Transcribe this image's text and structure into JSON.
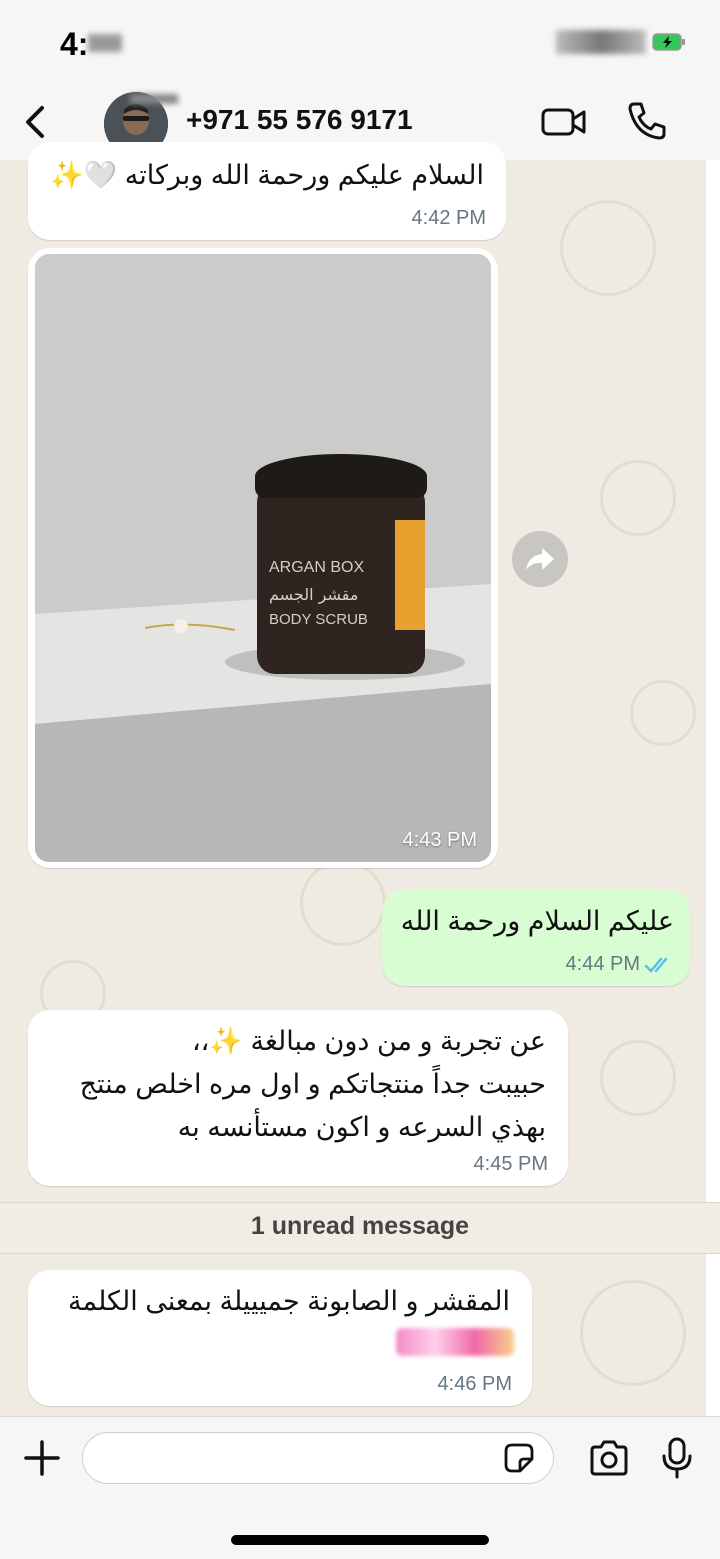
{
  "status_bar": {
    "time": "4:"
  },
  "header": {
    "contact_name": "+971 55 576 9171",
    "icons": [
      "back-chevron-icon",
      "video-call-icon",
      "phone-call-icon"
    ]
  },
  "messages": [
    {
      "direction": "incoming",
      "text": "السلام عليكم ورحمة الله وبركاته 🤍✨",
      "time": "4:42 PM"
    },
    {
      "direction": "incoming",
      "type": "image",
      "image_label_brand": "ARGAN BOX",
      "image_label_arabic": "مقشر الجسم",
      "image_label_product": "BODY SCRUB",
      "time": "4:43 PM"
    },
    {
      "direction": "outgoing",
      "text": "عليكم السلام ورحمة الله",
      "time": "4:44 PM",
      "status": "read"
    },
    {
      "direction": "incoming",
      "text": "عن تجربة و من دون مبالغة ✨،،\nحبيبت جداً منتجاتكم و اول مره اخلص منتج\nبهذي السرعه و اكون مستأنسه به",
      "time": "4:45 PM"
    },
    {
      "direction": "incoming",
      "text": "المقشر و الصابونة جميييلة بمعنى الكلمة",
      "time": "4:46 PM"
    }
  ],
  "unread_divider": "1 unread message",
  "input": {
    "value": "",
    "placeholder": ""
  },
  "colors": {
    "chat_background": "#efeae2",
    "incoming_bubble": "#ffffff",
    "outgoing_bubble": "#d9fdd3",
    "read_ticks": "#53bdeb"
  }
}
